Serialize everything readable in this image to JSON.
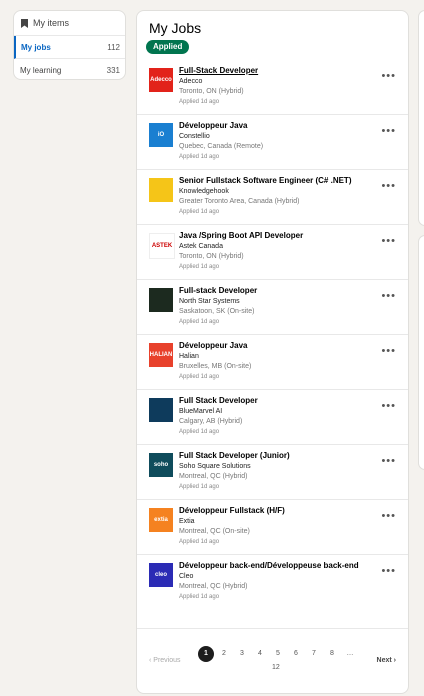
{
  "sidebar": {
    "title": "My items",
    "items": [
      {
        "label": "My jobs",
        "count": "112"
      },
      {
        "label": "My learning",
        "count": "331"
      }
    ]
  },
  "main": {
    "title": "My Jobs",
    "filter_pill": "Applied",
    "jobs": [
      {
        "title": "Full-Stack Developer",
        "company": "Adecco",
        "location": "Toronto, ON (Hybrid)",
        "applied": "Applied 1d ago",
        "logo_text": "Adecco",
        "logo_color": "#e2231a"
      },
      {
        "title": "Développeur Java",
        "company": "Constellio",
        "location": "Quebec, Canada (Remote)",
        "applied": "Applied 1d ago",
        "logo_text": "iO",
        "logo_color": "#1a7fd1"
      },
      {
        "title": "Senior Fullstack Software Engineer (C# .NET)",
        "company": "Knowledgehook",
        "location": "Greater Toronto Area, Canada (Hybrid)",
        "applied": "Applied 1d ago",
        "logo_text": "",
        "logo_color": "#f5c518"
      },
      {
        "title": "Java /Spring Boot API Developer",
        "company": "Astek Canada",
        "location": "Toronto, ON (Hybrid)",
        "applied": "Applied 1d ago",
        "logo_text": "ASTEK",
        "logo_color": "#ffffff"
      },
      {
        "title": "Full-stack Developer",
        "company": "North Star Systems",
        "location": "Saskatoon, SK (On-site)",
        "applied": "Applied 1d ago",
        "logo_text": "",
        "logo_color": "#1c2a1f"
      },
      {
        "title": "Développeur Java",
        "company": "Halian",
        "location": "Bruxelles, MB (On-site)",
        "applied": "Applied 1d ago",
        "logo_text": "HALIAN",
        "logo_color": "#e8412c"
      },
      {
        "title": "Full Stack Developer",
        "company": "BlueMarvel AI",
        "location": "Calgary, AB (Hybrid)",
        "applied": "Applied 1d ago",
        "logo_text": "",
        "logo_color": "#0e3b5c"
      },
      {
        "title": "Full Stack Developer (Junior)",
        "company": "Soho Square Solutions",
        "location": "Montreal, QC (Hybrid)",
        "applied": "Applied 1d ago",
        "logo_text": "soho",
        "logo_color": "#0f4c5c"
      },
      {
        "title": "Développeur Fullstack (H/F)",
        "company": "Extia",
        "location": "Montreal, QC (On-site)",
        "applied": "Applied 1d ago",
        "logo_text": "extia",
        "logo_color": "#f58220"
      },
      {
        "title": "Développeur back-end/Développeuse back-end",
        "company": "Cleo",
        "location": "Montreal, QC (Hybrid)",
        "applied": "Applied 1d ago",
        "logo_text": "cleo",
        "logo_color": "#2b2bb5"
      }
    ]
  },
  "pagination": {
    "previous": "Previous",
    "next": "Next",
    "pages": [
      "1",
      "2",
      "3",
      "4",
      "5",
      "6",
      "7",
      "8",
      "…"
    ],
    "last_page": "12",
    "current": "1"
  }
}
